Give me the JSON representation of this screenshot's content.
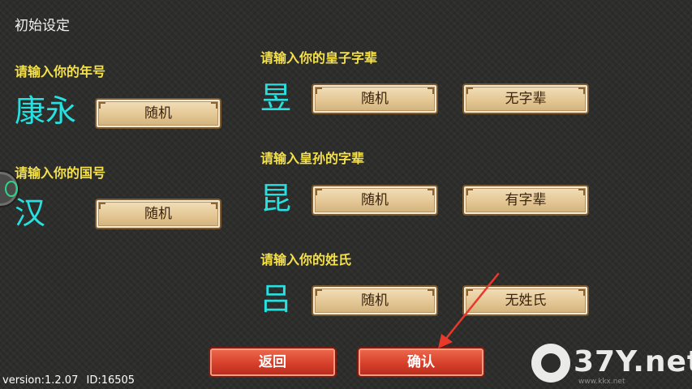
{
  "window": {
    "title": "初始设定"
  },
  "left": {
    "era": {
      "prompt": "请输入你的年号",
      "value": "康永",
      "random_label": "随机"
    },
    "country": {
      "prompt": "请输入你的国号",
      "value": "汉",
      "random_label": "随机"
    }
  },
  "right": {
    "prince": {
      "prompt": "请输入你的皇子字辈",
      "value": "昱",
      "random_label": "随机",
      "toggle_label": "无字辈"
    },
    "grandson": {
      "prompt": "请输入皇孙的字辈",
      "value": "昆",
      "random_label": "随机",
      "toggle_label": "有字辈"
    },
    "surname": {
      "prompt": "请输入你的姓氏",
      "value": "吕",
      "random_label": "随机",
      "toggle_label": "无姓氏"
    }
  },
  "footer": {
    "back_label": "返回",
    "confirm_label": "确认",
    "version": "version:1.2.07",
    "id": "ID:16505"
  },
  "watermark": {
    "brand": "37Y.net",
    "sub": "www.kkx.net"
  },
  "colors": {
    "background": "#2d2d2b",
    "prompt_text": "#f5e14a",
    "value_text": "#29e0e0",
    "button_tan": "#e4c794",
    "button_red": "#d6402b",
    "arrow": "#e8392a"
  }
}
